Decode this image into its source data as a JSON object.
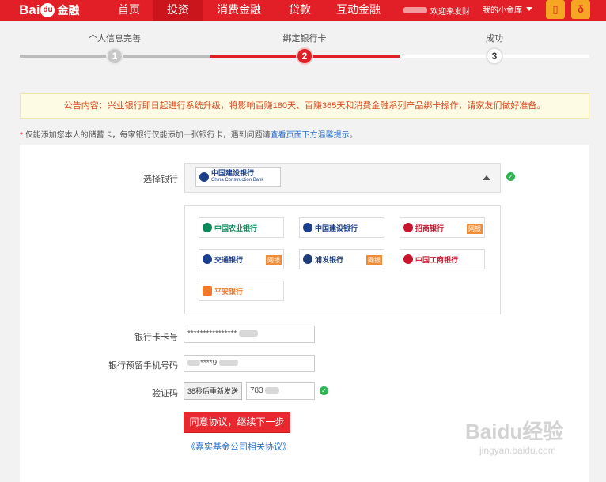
{
  "header": {
    "logo_text_a": "Bai",
    "logo_text_b": "du",
    "logo_text_c": "金融",
    "nav": [
      "首页",
      "投资",
      "消费金融",
      "贷款",
      "互动金融"
    ],
    "welcome": "欢迎来发财",
    "my_account": "我的小金库",
    "icon_phone": "phone-icon",
    "icon_logo": "baidu-finance-icon"
  },
  "steps": {
    "labels": [
      "个人信息完善",
      "绑定银行卡",
      "成功"
    ],
    "numbers": [
      "1",
      "2",
      "3"
    ],
    "current": 2,
    "colors": {
      "done": "#bcbcbc",
      "active": "#e21f26",
      "todo": "#ffffff"
    }
  },
  "notice": "公告内容：兴业银行即日起进行系统升级，将影响百赚180天、百赚365天和消费金融系列产品绑卡操作，请家友们做好准备。",
  "hint": {
    "star": "*",
    "text": "仅能添加您本人的储蓄卡，每家银行仅能添加一张银行卡，遇到问题请",
    "link": "查看页面下方温馨提示",
    "end": "。"
  },
  "form": {
    "bank_label": "选择银行",
    "selected_bank": "中国建设银行",
    "selected_bank_en": "China Construction Bank",
    "banks": [
      {
        "name": "中国农业银行",
        "color": "#0a8a5a",
        "tag": ""
      },
      {
        "name": "中国建设银行",
        "color": "#1a3f8b",
        "tag": ""
      },
      {
        "name": "招商银行",
        "color": "#c8152d",
        "tag": "网银"
      },
      {
        "name": "交通银行",
        "color": "#1d3f8f",
        "tag": "网银"
      },
      {
        "name": "浦发银行",
        "color": "#1f3d7a",
        "tag": "网银"
      },
      {
        "name": "中国工商银行",
        "color": "#c8152d",
        "tag": ""
      },
      {
        "name": "平安银行",
        "color": "#f07a2a",
        "tag": ""
      }
    ],
    "card_label": "银行卡卡号",
    "card_value": "****************",
    "phone_label": "银行预留手机号码",
    "phone_value": "****9",
    "code_label": "验证码",
    "sms_button": "38秒后重新发送",
    "code_value": "783",
    "submit": "同意协议，继续下一步",
    "agreement": "《嘉实基金公司相关协议》"
  },
  "watermark": {
    "main": "Baidu经验",
    "sub": "jingyan.baidu.com"
  }
}
